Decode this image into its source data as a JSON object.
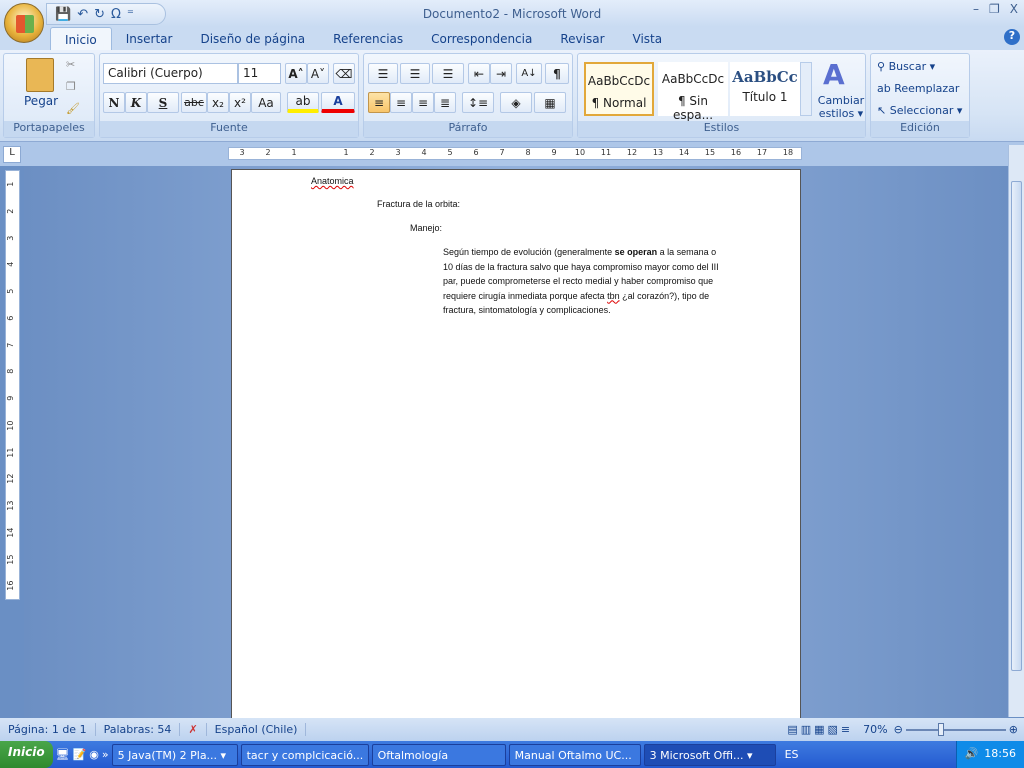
{
  "window": {
    "title": "Documento2 - Microsoft Word",
    "minimize": "–",
    "restore": "❐",
    "close": "X"
  },
  "qat": {
    "save": "💾",
    "undo": "↶",
    "redo": "↻",
    "symbol": "Ω",
    "more": "⁼"
  },
  "tabs": [
    "Inicio",
    "Insertar",
    "Diseño de página",
    "Referencias",
    "Correspondencia",
    "Revisar",
    "Vista"
  ],
  "help": "?",
  "ribbon": {
    "clipboard": {
      "label": "Portapapeles",
      "paste": "Pegar"
    },
    "font": {
      "label": "Fuente",
      "font_name": "Calibri (Cuerpo)",
      "font_size": "11",
      "bold": "N",
      "italic": "K",
      "underline": "S",
      "strike": "abc",
      "subscript": "x₂",
      "superscript": "x²",
      "case": "Aa",
      "grow": "A˄",
      "shrink": "A˅",
      "highlight": "ab",
      "color": "A"
    },
    "paragraph": {
      "label": "Párrafo",
      "pilcrow": "¶",
      "sort": "A↓"
    },
    "styles": {
      "label": "Estilos",
      "items": [
        {
          "preview": "AaBbCcDc",
          "name": "¶ Normal"
        },
        {
          "preview": "AaBbCcDc",
          "name": "¶ Sin espa..."
        },
        {
          "preview": "AaBbCc",
          "name": "Título 1"
        }
      ],
      "change": "Cambiar estilos ▾"
    },
    "editing": {
      "label": "Edición",
      "find": "Buscar ▾",
      "replace": "Reemplazar",
      "select": "Seleccionar ▾"
    }
  },
  "ruler": {
    "h": [
      "3",
      "2",
      "1",
      "",
      "1",
      "2",
      "3",
      "4",
      "5",
      "6",
      "7",
      "8",
      "9",
      "10",
      "11",
      "12",
      "13",
      "14",
      "15",
      "16",
      "17",
      "18"
    ],
    "v": [
      "1",
      "2",
      "3",
      "4",
      "5",
      "6",
      "7",
      "8",
      "9",
      "10",
      "11",
      "12",
      "13",
      "14",
      "15",
      "16"
    ],
    "tab_selector": "L"
  },
  "document": {
    "lines": [
      "Anatomica",
      "Fractura de la orbita:",
      "Manejo:"
    ],
    "paragraph": [
      "Según tiempo de evolución (generalmente ",
      "se operan",
      " a la  semana o 10 días de la fractura salvo que haya compromiso mayor como del III par, puede comprometerse  el recto medial  y haber compromiso que  requiere cirugía inmediata  porque afecta ",
      "tbn",
      " ¿al corazón?), tipo de fractura, sintomatología   y complicaciones."
    ]
  },
  "status": {
    "page": "Página: 1 de 1",
    "words": "Palabras: 54",
    "language": "Español (Chile)",
    "zoom": "70%",
    "zoom_level": 70
  },
  "taskbar": {
    "start": "Inicio",
    "items": [
      "5 Java(TM) 2 Pla... ▾",
      "tacr y complcicació...",
      "Oftalmología",
      "Manual Oftalmo UC...",
      "3 Microsoft Offi... ▾"
    ],
    "lang": "ES",
    "clock": "18:56",
    "more": "»"
  }
}
